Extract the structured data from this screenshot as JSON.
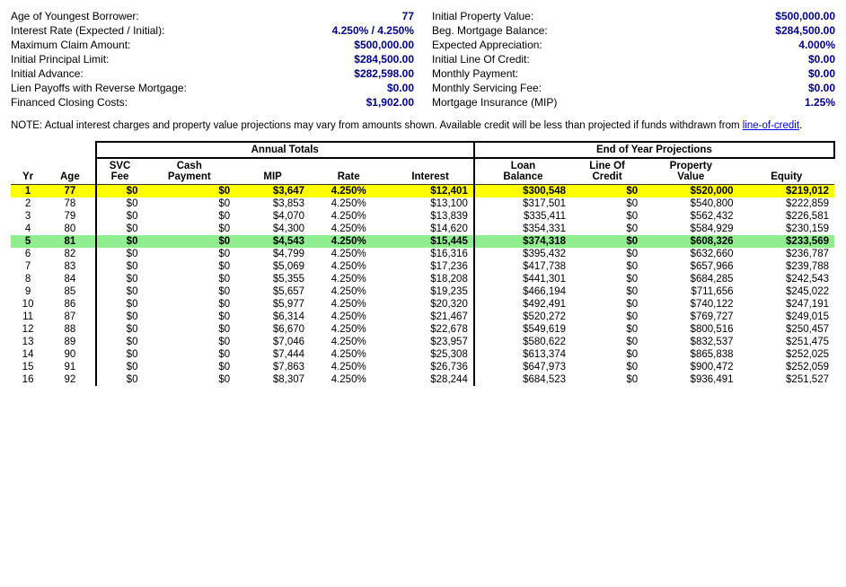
{
  "leftInfo": [
    {
      "label": "Age of Youngest Borrower:",
      "value": "77",
      "plain": true
    },
    {
      "label": "Interest Rate (Expected / Initial):",
      "value": "4.250%  /  4.250%",
      "plain": true
    },
    {
      "label": "Maximum Claim Amount:",
      "value": "$500,000.00"
    },
    {
      "label": "Initial Principal Limit:",
      "value": "$284,500.00"
    },
    {
      "label": "Initial Advance:",
      "value": "$282,598.00"
    },
    {
      "label": "Lien Payoffs with Reverse Mortgage:",
      "value": "$0.00"
    },
    {
      "label": "Financed Closing Costs:",
      "value": "$1,902.00"
    }
  ],
  "rightInfo": [
    {
      "label": "Initial Property Value:",
      "value": "$500,000.00"
    },
    {
      "label": "Beg. Mortgage Balance:",
      "value": "$284,500.00"
    },
    {
      "label": "Expected Appreciation:",
      "value": "4.000%",
      "plain": true
    },
    {
      "label": "Initial Line Of Credit:",
      "value": "$0.00"
    },
    {
      "label": "Monthly Payment:",
      "value": "$0.00"
    },
    {
      "label": "Monthly Servicing Fee:",
      "value": "$0.00"
    },
    {
      "label": "Mortgage Insurance (MIP)",
      "value": "1.25%",
      "plain": true
    }
  ],
  "note": "NOTE:  Actual interest charges and property value projections may vary from amounts shown.  Available credit will be less than projected if funds withdrawn from line-of-credit.",
  "tableHeaders": {
    "annualSection": "Annual Totals",
    "eoySection": "End of Year Projections",
    "cols": {
      "yr": "Yr",
      "age": "Age",
      "svc": "SVC Fee",
      "cash": "Cash Payment",
      "mip": "MIP",
      "rate": "Rate",
      "interest": "Interest",
      "loan": "Loan Balance",
      "loc": "Line Of Credit",
      "prop": "Property Value",
      "equity": "Equity"
    }
  },
  "rows": [
    {
      "yr": 1,
      "age": 77,
      "svc": "$0",
      "cash": "$0",
      "mip": "$3,647",
      "rate": "4.250%",
      "interest": "$12,401",
      "loan": "$300,548",
      "loc": "$0",
      "prop": "$520,000",
      "equity": "$219,012",
      "highlight": "yellow"
    },
    {
      "yr": 2,
      "age": 78,
      "svc": "$0",
      "cash": "$0",
      "mip": "$3,853",
      "rate": "4.250%",
      "interest": "$13,100",
      "loan": "$317,501",
      "loc": "$0",
      "prop": "$540,800",
      "equity": "$222,859"
    },
    {
      "yr": 3,
      "age": 79,
      "svc": "$0",
      "cash": "$0",
      "mip": "$4,070",
      "rate": "4.250%",
      "interest": "$13,839",
      "loan": "$335,411",
      "loc": "$0",
      "prop": "$562,432",
      "equity": "$226,581"
    },
    {
      "yr": 4,
      "age": 80,
      "svc": "$0",
      "cash": "$0",
      "mip": "$4,300",
      "rate": "4.250%",
      "interest": "$14,620",
      "loan": "$354,331",
      "loc": "$0",
      "prop": "$584,929",
      "equity": "$230,159"
    },
    {
      "yr": 5,
      "age": 81,
      "svc": "$0",
      "cash": "$0",
      "mip": "$4,543",
      "rate": "4.250%",
      "interest": "$15,445",
      "loan": "$374,318",
      "loc": "$0",
      "prop": "$608,326",
      "equity": "$233,569",
      "highlight": "green"
    },
    {
      "yr": 6,
      "age": 82,
      "svc": "$0",
      "cash": "$0",
      "mip": "$4,799",
      "rate": "4.250%",
      "interest": "$16,316",
      "loan": "$395,432",
      "loc": "$0",
      "prop": "$632,660",
      "equity": "$236,787"
    },
    {
      "yr": 7,
      "age": 83,
      "svc": "$0",
      "cash": "$0",
      "mip": "$5,069",
      "rate": "4.250%",
      "interest": "$17,236",
      "loan": "$417,738",
      "loc": "$0",
      "prop": "$657,966",
      "equity": "$239,788"
    },
    {
      "yr": 8,
      "age": 84,
      "svc": "$0",
      "cash": "$0",
      "mip": "$5,355",
      "rate": "4.250%",
      "interest": "$18,208",
      "loan": "$441,301",
      "loc": "$0",
      "prop": "$684,285",
      "equity": "$242,543"
    },
    {
      "yr": 9,
      "age": 85,
      "svc": "$0",
      "cash": "$0",
      "mip": "$5,657",
      "rate": "4.250%",
      "interest": "$19,235",
      "loan": "$466,194",
      "loc": "$0",
      "prop": "$711,656",
      "equity": "$245,022"
    },
    {
      "yr": 10,
      "age": 86,
      "svc": "$0",
      "cash": "$0",
      "mip": "$5,977",
      "rate": "4.250%",
      "interest": "$20,320",
      "loan": "$492,491",
      "loc": "$0",
      "prop": "$740,122",
      "equity": "$247,191"
    },
    {
      "yr": 11,
      "age": 87,
      "svc": "$0",
      "cash": "$0",
      "mip": "$6,314",
      "rate": "4.250%",
      "interest": "$21,467",
      "loan": "$520,272",
      "loc": "$0",
      "prop": "$769,727",
      "equity": "$249,015"
    },
    {
      "yr": 12,
      "age": 88,
      "svc": "$0",
      "cash": "$0",
      "mip": "$6,670",
      "rate": "4.250%",
      "interest": "$22,678",
      "loan": "$549,619",
      "loc": "$0",
      "prop": "$800,516",
      "equity": "$250,457"
    },
    {
      "yr": 13,
      "age": 89,
      "svc": "$0",
      "cash": "$0",
      "mip": "$7,046",
      "rate": "4.250%",
      "interest": "$23,957",
      "loan": "$580,622",
      "loc": "$0",
      "prop": "$832,537",
      "equity": "$251,475"
    },
    {
      "yr": 14,
      "age": 90,
      "svc": "$0",
      "cash": "$0",
      "mip": "$7,444",
      "rate": "4.250%",
      "interest": "$25,308",
      "loan": "$613,374",
      "loc": "$0",
      "prop": "$865,838",
      "equity": "$252,025"
    },
    {
      "yr": 15,
      "age": 91,
      "svc": "$0",
      "cash": "$0",
      "mip": "$7,863",
      "rate": "4.250%",
      "interest": "$26,736",
      "loan": "$647,973",
      "loc": "$0",
      "prop": "$900,472",
      "equity": "$252,059"
    },
    {
      "yr": 16,
      "age": 92,
      "svc": "$0",
      "cash": "$0",
      "mip": "$8,307",
      "rate": "4.250%",
      "interest": "$28,244",
      "loan": "$684,523",
      "loc": "$0",
      "prop": "$936,491",
      "equity": "$251,527"
    }
  ]
}
